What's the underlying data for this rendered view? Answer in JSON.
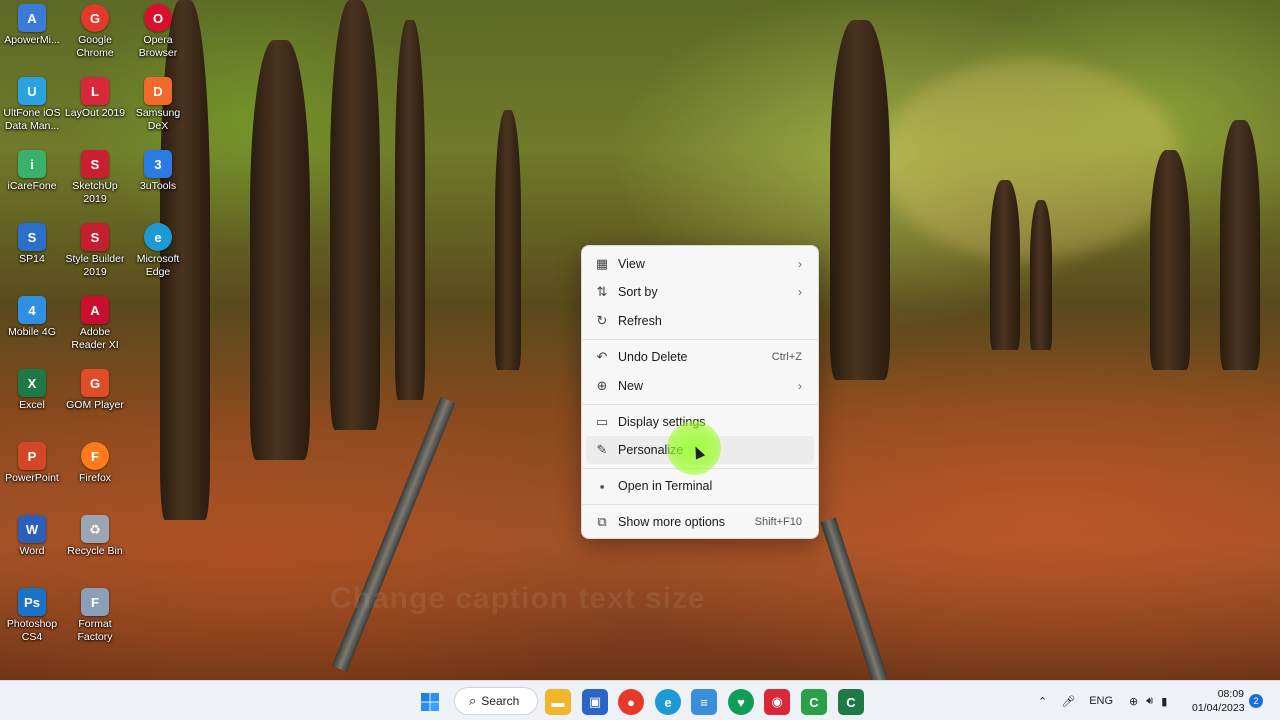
{
  "desktop": {
    "icons": [
      {
        "label": "ApowerMi...",
        "icon": "apowermirror-icon",
        "color": "#3b7bd8"
      },
      {
        "label": "Google Chrome",
        "icon": "chrome-icon",
        "color": "#e5392b"
      },
      {
        "label": "Opera Browser",
        "icon": "opera-icon",
        "color": "#d8102c"
      },
      {
        "label": "UltFone iOS Data Man...",
        "icon": "ultfone-icon",
        "color": "#2aa1e0"
      },
      {
        "label": "LayOut 2019",
        "icon": "layout-icon",
        "color": "#d8283a"
      },
      {
        "label": "Samsung DeX",
        "icon": "samsung-dex-icon",
        "color": "#f26a2b"
      },
      {
        "label": "iCareFone",
        "icon": "icarefone-icon",
        "color": "#3ab06a"
      },
      {
        "label": "SketchUp 2019",
        "icon": "sketchup-icon",
        "color": "#c8202e"
      },
      {
        "label": "3uTools",
        "icon": "3utools-icon",
        "color": "#2c7be5"
      },
      {
        "label": "SP14",
        "icon": "sp14-icon",
        "color": "#2a6fc8"
      },
      {
        "label": "Style Builder 2019",
        "icon": "style-builder-icon",
        "color": "#c41f2f"
      },
      {
        "label": "Microsoft Edge",
        "icon": "edge-icon",
        "color": "#1c9ad6"
      },
      {
        "label": "Mobile 4G",
        "icon": "mobile-4g-icon",
        "color": "#2f8fe0"
      },
      {
        "label": "Adobe Reader XI",
        "icon": "adobe-reader-icon",
        "color": "#c8102e"
      },
      {
        "label": "Excel",
        "icon": "excel-icon",
        "color": "#1d7a45"
      },
      {
        "label": "GOM Player",
        "icon": "gom-player-icon",
        "color": "#e04b2a"
      },
      {
        "label": "PowerPoint",
        "icon": "powerpoint-icon",
        "color": "#d24726"
      },
      {
        "label": "Firefox",
        "icon": "firefox-icon",
        "color": "#ff7a1a"
      },
      {
        "label": "Word",
        "icon": "word-icon",
        "color": "#2b5fb8"
      },
      {
        "label": "Recycle Bin",
        "icon": "recycle-bin-icon",
        "color": "#9aa6b4"
      },
      {
        "label": "Photoshop CS4",
        "icon": "photoshop-icon",
        "color": "#1b73c8"
      },
      {
        "label": "Format Factory",
        "icon": "format-factory-icon",
        "color": "#8aa0b8"
      }
    ],
    "icon_glyphs": [
      "A",
      "G",
      "O",
      "U",
      "L",
      "D",
      "i",
      "S",
      "3",
      "S",
      "S",
      "e",
      "4",
      "A",
      "X",
      "G",
      "P",
      "F",
      "W",
      "♻",
      "Ps",
      "F"
    ]
  },
  "context_menu": {
    "items": [
      {
        "label": "View",
        "icon": "grid-view-icon",
        "shortcut": "",
        "submenu": true
      },
      {
        "label": "Sort by",
        "icon": "sort-icon",
        "shortcut": "",
        "submenu": true
      },
      {
        "label": "Refresh",
        "icon": "refresh-icon",
        "shortcut": "",
        "submenu": false
      },
      {
        "label": "Undo Delete",
        "icon": "undo-icon",
        "shortcut": "Ctrl+Z",
        "submenu": false
      },
      {
        "label": "New",
        "icon": "new-plus-icon",
        "shortcut": "",
        "submenu": true
      },
      {
        "label": "Display settings",
        "icon": "display-settings-icon",
        "shortcut": "",
        "submenu": false
      },
      {
        "label": "Personalize",
        "icon": "pen-icon",
        "shortcut": "",
        "submenu": false
      },
      {
        "label": "Open in Terminal",
        "icon": "terminal-icon",
        "shortcut": "",
        "submenu": false
      },
      {
        "label": "Show more options",
        "icon": "more-options-icon",
        "shortcut": "Shift+F10",
        "submenu": false
      }
    ],
    "hovered": "Personalize"
  },
  "taskbar": {
    "search_label": "Search",
    "apps": [
      {
        "icon": "start-icon",
        "color": "#1f7fe0"
      },
      {
        "icon": "file-explorer-icon",
        "color": "#f2b62a"
      },
      {
        "icon": "microsoft-store-icon",
        "color": "#2b64c8"
      },
      {
        "icon": "chrome-icon",
        "color": "#e5392b"
      },
      {
        "icon": "edge-icon",
        "color": "#1c9ad6"
      },
      {
        "icon": "notepad-icon",
        "color": "#3a8fd8"
      },
      {
        "icon": "kaspersky-icon",
        "color": "#0f9d58"
      },
      {
        "icon": "screen-recorder-icon",
        "color": "#d8283a"
      },
      {
        "icon": "camtasia-icon",
        "color": "#2aa048"
      },
      {
        "icon": "excel-icon",
        "color": "#1d7a45"
      }
    ],
    "tray": {
      "language": "ENG",
      "time": "08:09",
      "date": "01/04/2023",
      "notification_count": "2"
    }
  },
  "watermark": "Change caption text size"
}
